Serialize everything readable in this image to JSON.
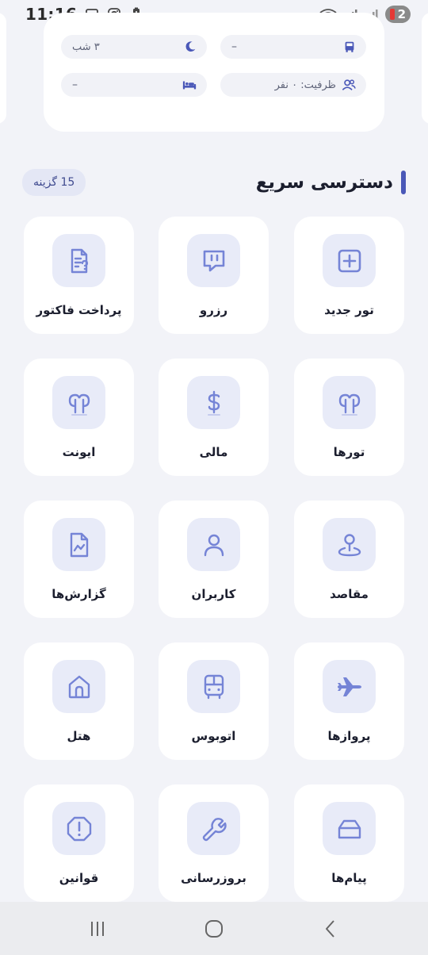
{
  "status_bar": {
    "time": "11:16",
    "battery_level": "2",
    "left_icons": [
      "screenshot-icon",
      "instagram-icon",
      "battery-alert-icon",
      "dot-icon"
    ],
    "right_icons": [
      "wifi-icon",
      "signal-icon",
      "signal-icon-2",
      "battery-icon"
    ]
  },
  "info_card": {
    "nights": "۳ شب",
    "transport": "–",
    "capacity": "ظرفیت: ۰ نفر",
    "accommodation": "–"
  },
  "quick_access": {
    "title": "دسترسی سریع",
    "count_badge": "15 گزینه",
    "items": [
      {
        "label": "تور جدید",
        "icon": "plus-square-icon"
      },
      {
        "label": "رزرو",
        "icon": "chat-bubble-icon"
      },
      {
        "label": "پرداخت فاکتور",
        "icon": "invoice-icon"
      },
      {
        "label": "تورها",
        "icon": "trees-icon"
      },
      {
        "label": "مالی",
        "icon": "dollar-icon"
      },
      {
        "label": "ایونت",
        "icon": "trees-icon"
      },
      {
        "label": "مقاصد",
        "icon": "map-pin-icon"
      },
      {
        "label": "کاربران",
        "icon": "user-icon"
      },
      {
        "label": "گزارش‌ها",
        "icon": "report-icon"
      },
      {
        "label": "پروازها",
        "icon": "airplane-icon"
      },
      {
        "label": "اتوبوس",
        "icon": "bus-icon"
      },
      {
        "label": "هتل",
        "icon": "home-icon"
      },
      {
        "label": "پیام‌ها",
        "icon": "mailbox-icon"
      },
      {
        "label": "بروزرسانی",
        "icon": "wrench-icon"
      },
      {
        "label": "قوانین",
        "icon": "alert-octagon-icon"
      }
    ]
  },
  "colors": {
    "accent": "#4a58b8",
    "icon": "#7584d6",
    "icon_bg": "#e8ebf8",
    "background": "#f2f3f8"
  },
  "nav_bar": {
    "buttons": [
      "recent-apps-icon",
      "home-circle-icon",
      "back-icon"
    ]
  }
}
